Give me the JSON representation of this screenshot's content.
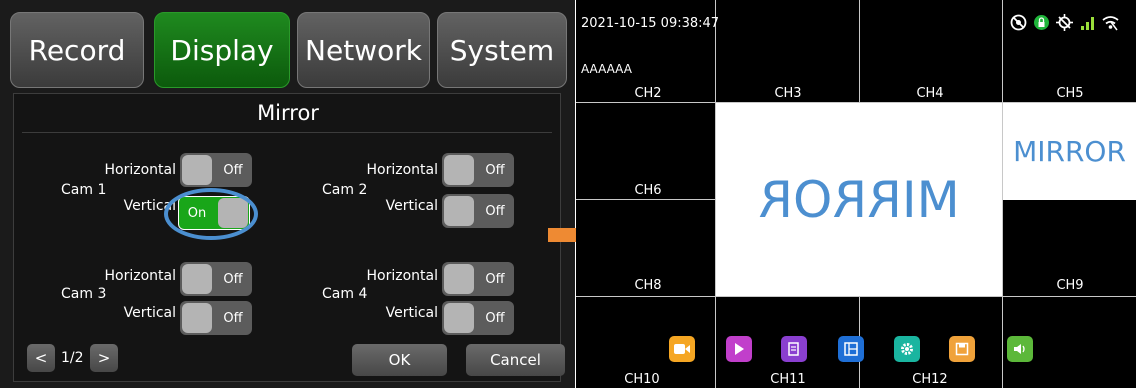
{
  "menu": {
    "tabs": [
      {
        "label": "Record",
        "active": false
      },
      {
        "label": "Display",
        "active": true
      },
      {
        "label": "Network",
        "active": false
      },
      {
        "label": "System",
        "active": false
      }
    ],
    "colors": {
      "active_tab": "#1f8a1f",
      "toggle_on": "#19a619",
      "highlight": "#4b8fd0"
    }
  },
  "mirror_dialog": {
    "title": "Mirror",
    "cameras": [
      {
        "label": "Cam 1",
        "horizontal_label": "Horizontal",
        "horizontal": "Off",
        "vertical_label": "Vertical",
        "vertical": "On"
      },
      {
        "label": "Cam 2",
        "horizontal_label": "Horizontal",
        "horizontal": "Off",
        "vertical_label": "Vertical",
        "vertical": "Off"
      },
      {
        "label": "Cam 3",
        "horizontal_label": "Horizontal",
        "horizontal": "Off",
        "vertical_label": "Vertical",
        "vertical": "Off"
      },
      {
        "label": "Cam 4",
        "horizontal_label": "Horizontal",
        "horizontal": "Off",
        "vertical_label": "Vertical",
        "vertical": "Off"
      }
    ],
    "pagination": {
      "prev": "<",
      "page": "1/2",
      "next": ">"
    },
    "ok_label": "OK",
    "cancel_label": "Cancel"
  },
  "monitor": {
    "timestamp": "2021-10-15 09:38:47",
    "device_name": "AAAAAA",
    "channels": {
      "ch2": "CH2",
      "ch3": "CH3",
      "ch4": "CH4",
      "ch5": "CH5",
      "ch6": "CH6",
      "ch8": "CH8",
      "ch9": "CH9",
      "ch10": "CH10",
      "ch11": "CH11",
      "ch12": "CH12"
    },
    "mirror_text_flipped": "MIRROR",
    "mirror_text": "MIRROR",
    "status_icons": [
      "no-record-icon",
      "lock-icon",
      "no-gps-icon",
      "signal-bars-icon",
      "wifi-icon"
    ],
    "dock": [
      {
        "icon": "camera-icon",
        "color": "#f5a623"
      },
      {
        "icon": "play-icon",
        "color": "#c13fcb"
      },
      {
        "icon": "edit-icon",
        "color": "#8a3fd0"
      },
      {
        "icon": "layout-icon",
        "color": "#1f6fd6"
      },
      {
        "icon": "gear-icon",
        "color": "#1ab5a0"
      },
      {
        "icon": "save-icon",
        "color": "#f0a23a"
      },
      {
        "icon": "volume-icon",
        "color": "#5cb83a"
      }
    ]
  }
}
